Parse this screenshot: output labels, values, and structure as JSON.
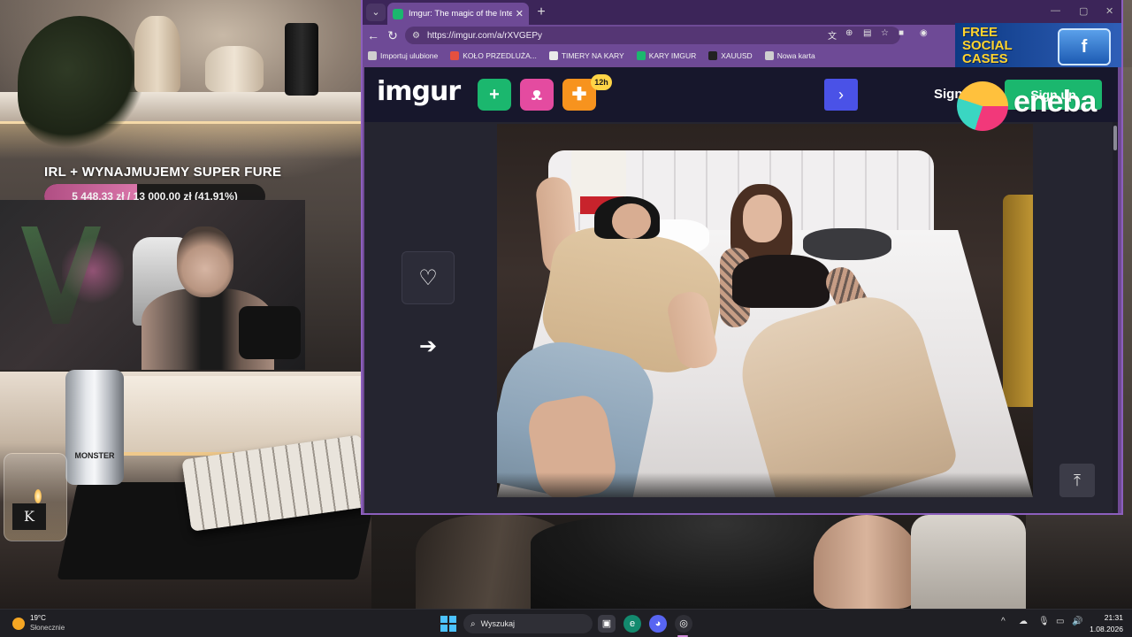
{
  "overlay": {
    "goal_title": "IRL + WYNAJMUJEMY SUPER FURE",
    "goal_text": "5 448,33 zł  /  13 000,00 zł (41.91%)",
    "goal_progress": 0.4191
  },
  "scene": {
    "candle_label": "K",
    "can_label": "MONSTER"
  },
  "browser": {
    "tab_title": "Imgur: The magic of the Internet",
    "url": "https://imgur.com/a/rXVGEPy",
    "bookmarks": [
      {
        "label": "Importuj ulubione",
        "color": "#cfcfcf"
      },
      {
        "label": "KOŁO PRZEDLUŻA...",
        "color": "#e5503f"
      },
      {
        "label": "TIMERY NA KARY",
        "color": "#e9e9e9"
      },
      {
        "label": "KARY IMGUR",
        "color": "#1bb76e"
      },
      {
        "label": "XAUUSD",
        "color": "#222222"
      },
      {
        "label": "Nowa karta",
        "color": "#cfcfcf"
      }
    ]
  },
  "imgur": {
    "logo": "imgur",
    "badge": "12h",
    "signin": "Sign in",
    "signup": "Sign up"
  },
  "ads": {
    "top_text": "FREE SOCIAL CASES",
    "brand": "eneba"
  },
  "taskbar": {
    "temperature": "19°C",
    "condition": "Słonecznie",
    "search_placeholder": "Wyszukaj",
    "time": "21:31",
    "date": "1.08.2026"
  },
  "colors": {
    "browser_frame": "#6e4a96",
    "imgur_green": "#1bb76e",
    "imgur_pink": "#e44ba0",
    "imgur_orange": "#f7931e",
    "imgur_blue": "#4a52e7",
    "goal_fill": "#d975a9"
  }
}
